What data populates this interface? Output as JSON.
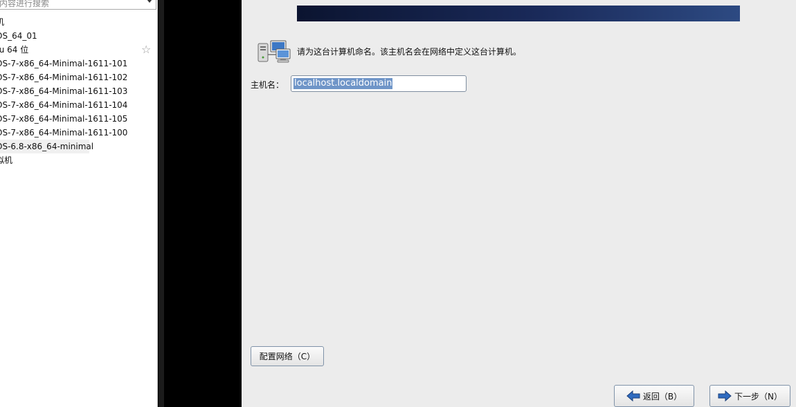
{
  "library": {
    "search_placeholder": "内容进行搜索",
    "items": [
      {
        "label": "机"
      },
      {
        "label": "OS_64_01"
      },
      {
        "label": "tu 64 位"
      },
      {
        "label": "OS-7-x86_64-Minimal-1611-101"
      },
      {
        "label": "OS-7-x86_64-Minimal-1611-102"
      },
      {
        "label": "OS-7-x86_64-Minimal-1611-103"
      },
      {
        "label": "OS-7-x86_64-Minimal-1611-104"
      },
      {
        "label": "OS-7-x86_64-Minimal-1611-105"
      },
      {
        "label": "OS-7-x86_64-Minimal-1611-100"
      },
      {
        "label": "OS-6.8-x86_64-minimal"
      },
      {
        "label": "拟机"
      }
    ],
    "selected_index": 9,
    "star_glyph": "☆"
  },
  "installer": {
    "prompt": "请为这台计算机命名。该主机名会在网络中定义这台计算机。",
    "hostname_label": "主机名：",
    "hostname_value": "localhost.localdomain",
    "configure_network_button": "配置网络（C）",
    "back_button": "返回（B）",
    "next_button": "下一步（N）"
  },
  "colors": {
    "banner_dark": "#0b1430",
    "selection": "#6f95c8",
    "panel_bg": "#ececec"
  },
  "icons": {
    "header": "network-computers-icon",
    "back": "arrow-left-icon",
    "next": "arrow-right-icon"
  }
}
